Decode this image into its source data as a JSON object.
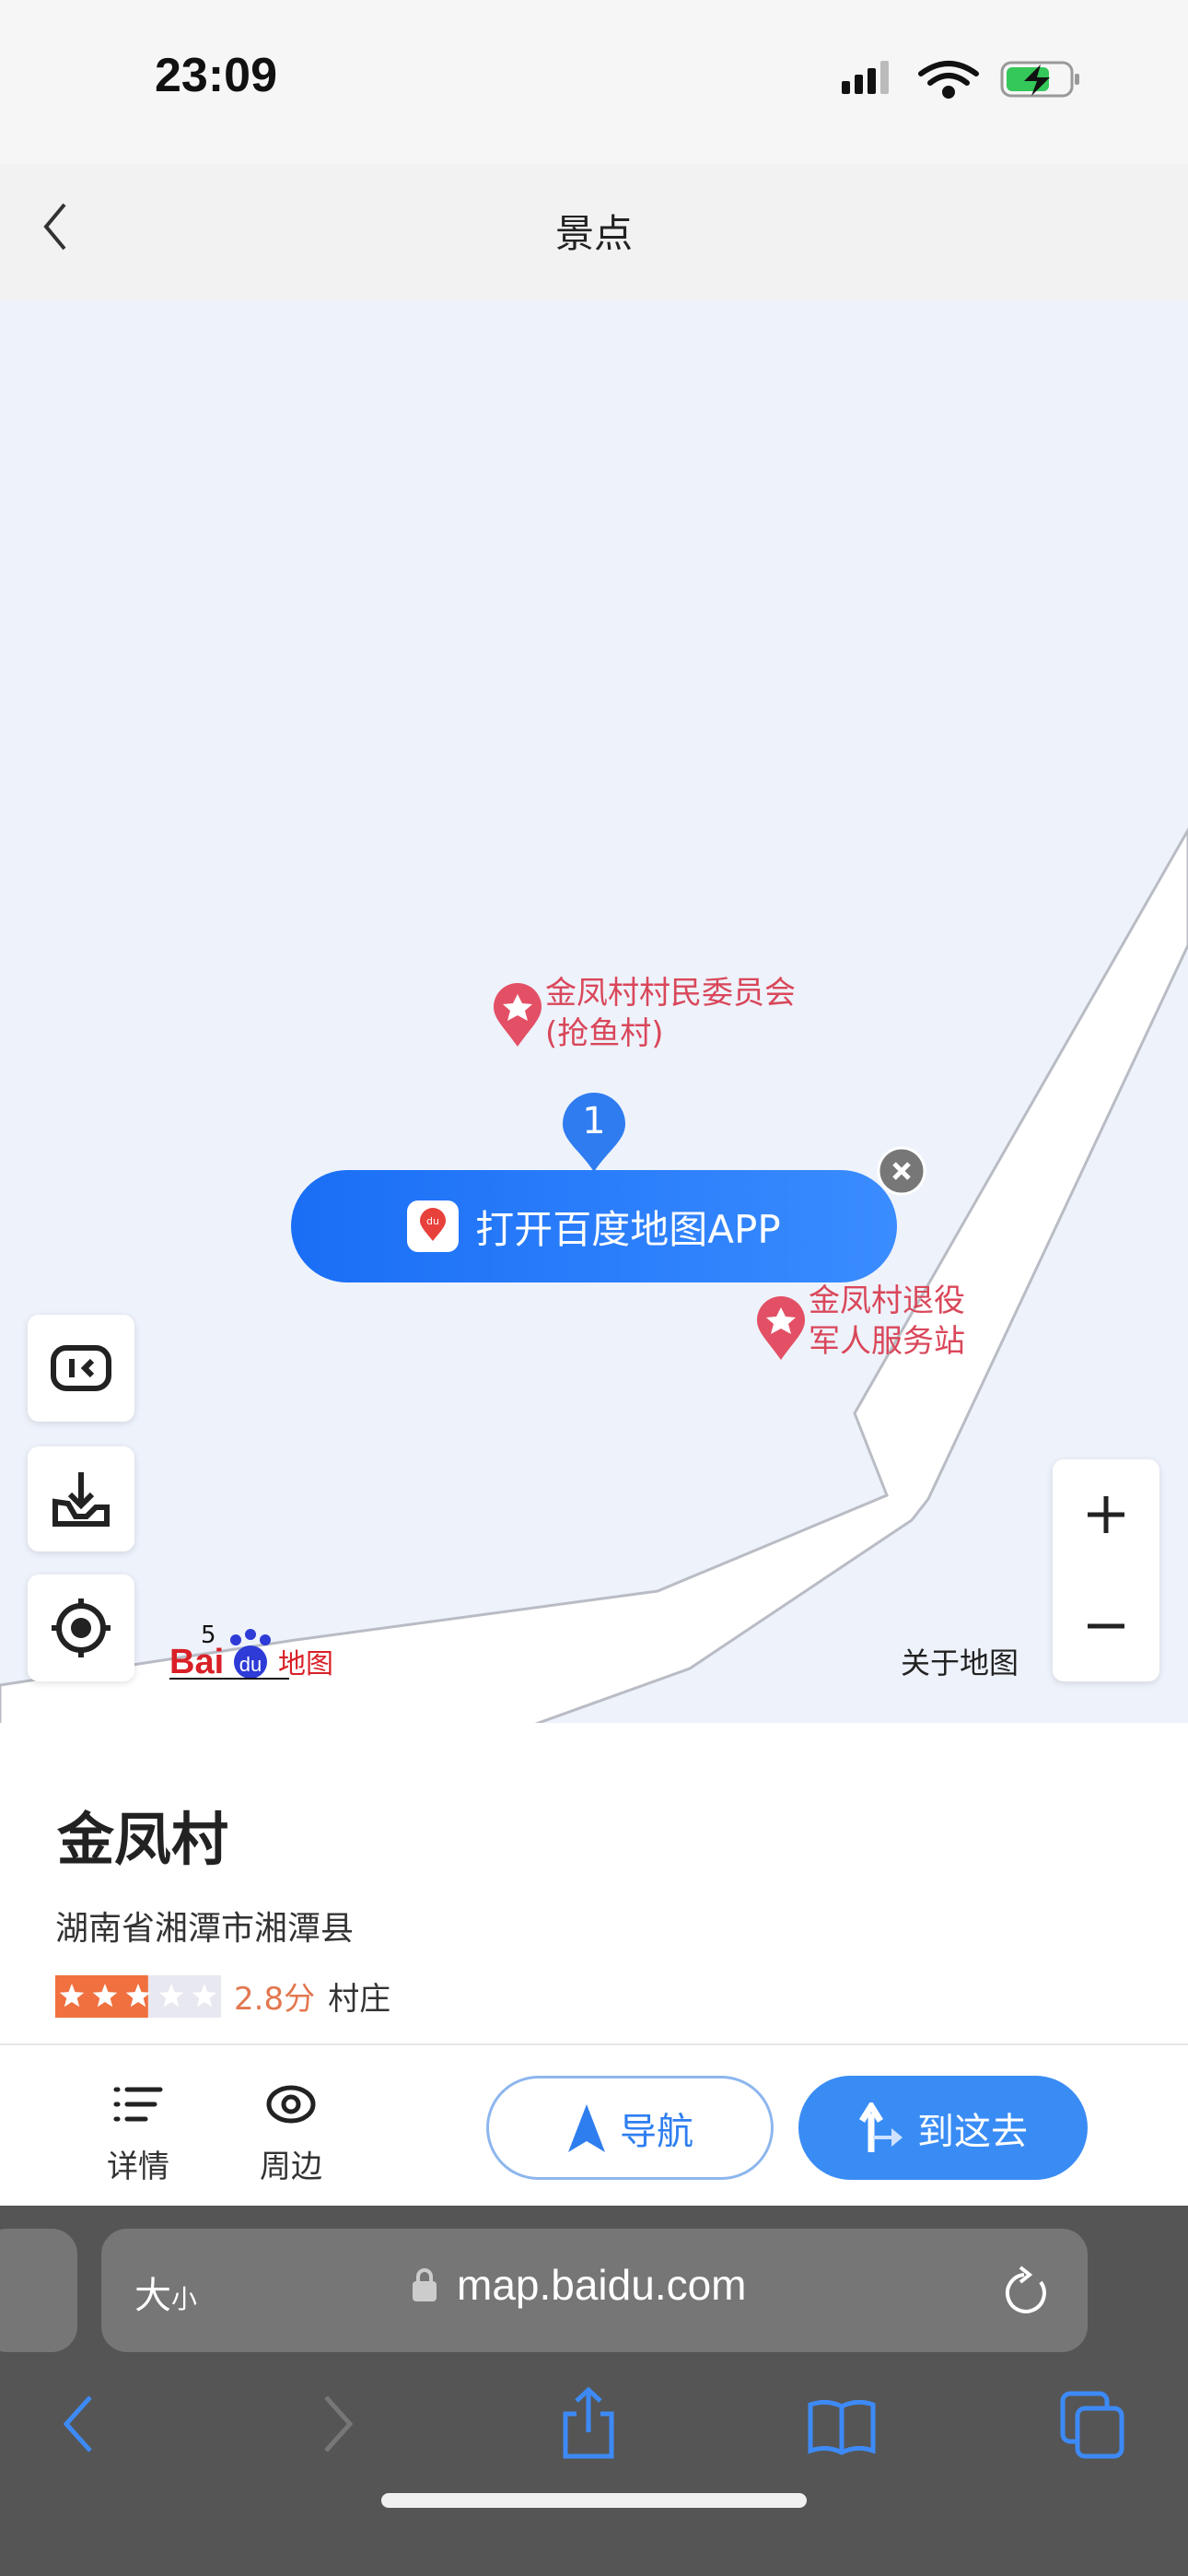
{
  "status_bar": {
    "time": "23:09"
  },
  "header": {
    "title": "景点"
  },
  "map": {
    "marker_label": "1",
    "open_app_label": "打开百度地图APP",
    "pois": [
      {
        "line1": "金凤村村民委员会",
        "line2": "(抢鱼村)"
      },
      {
        "line1": "金凤村退役",
        "line2": "军人服务站"
      }
    ],
    "logo_text": "Bai du 地图",
    "scale_label": "5",
    "about_label": "关于地图"
  },
  "place": {
    "name": "金凤村",
    "address": "湖南省湘潭市湘潭县",
    "rating": 2.8,
    "rating_max": 5,
    "rating_label": "2.8分",
    "category": "村庄",
    "star_color": "#f0703f"
  },
  "actions": {
    "details": "详情",
    "nearby": "周边",
    "navigate": "导航",
    "go_here": "到这去",
    "accent": "#3a8cf5"
  },
  "browser": {
    "text_size": "大",
    "text_size_small": "小",
    "url": "map.baidu.com"
  }
}
